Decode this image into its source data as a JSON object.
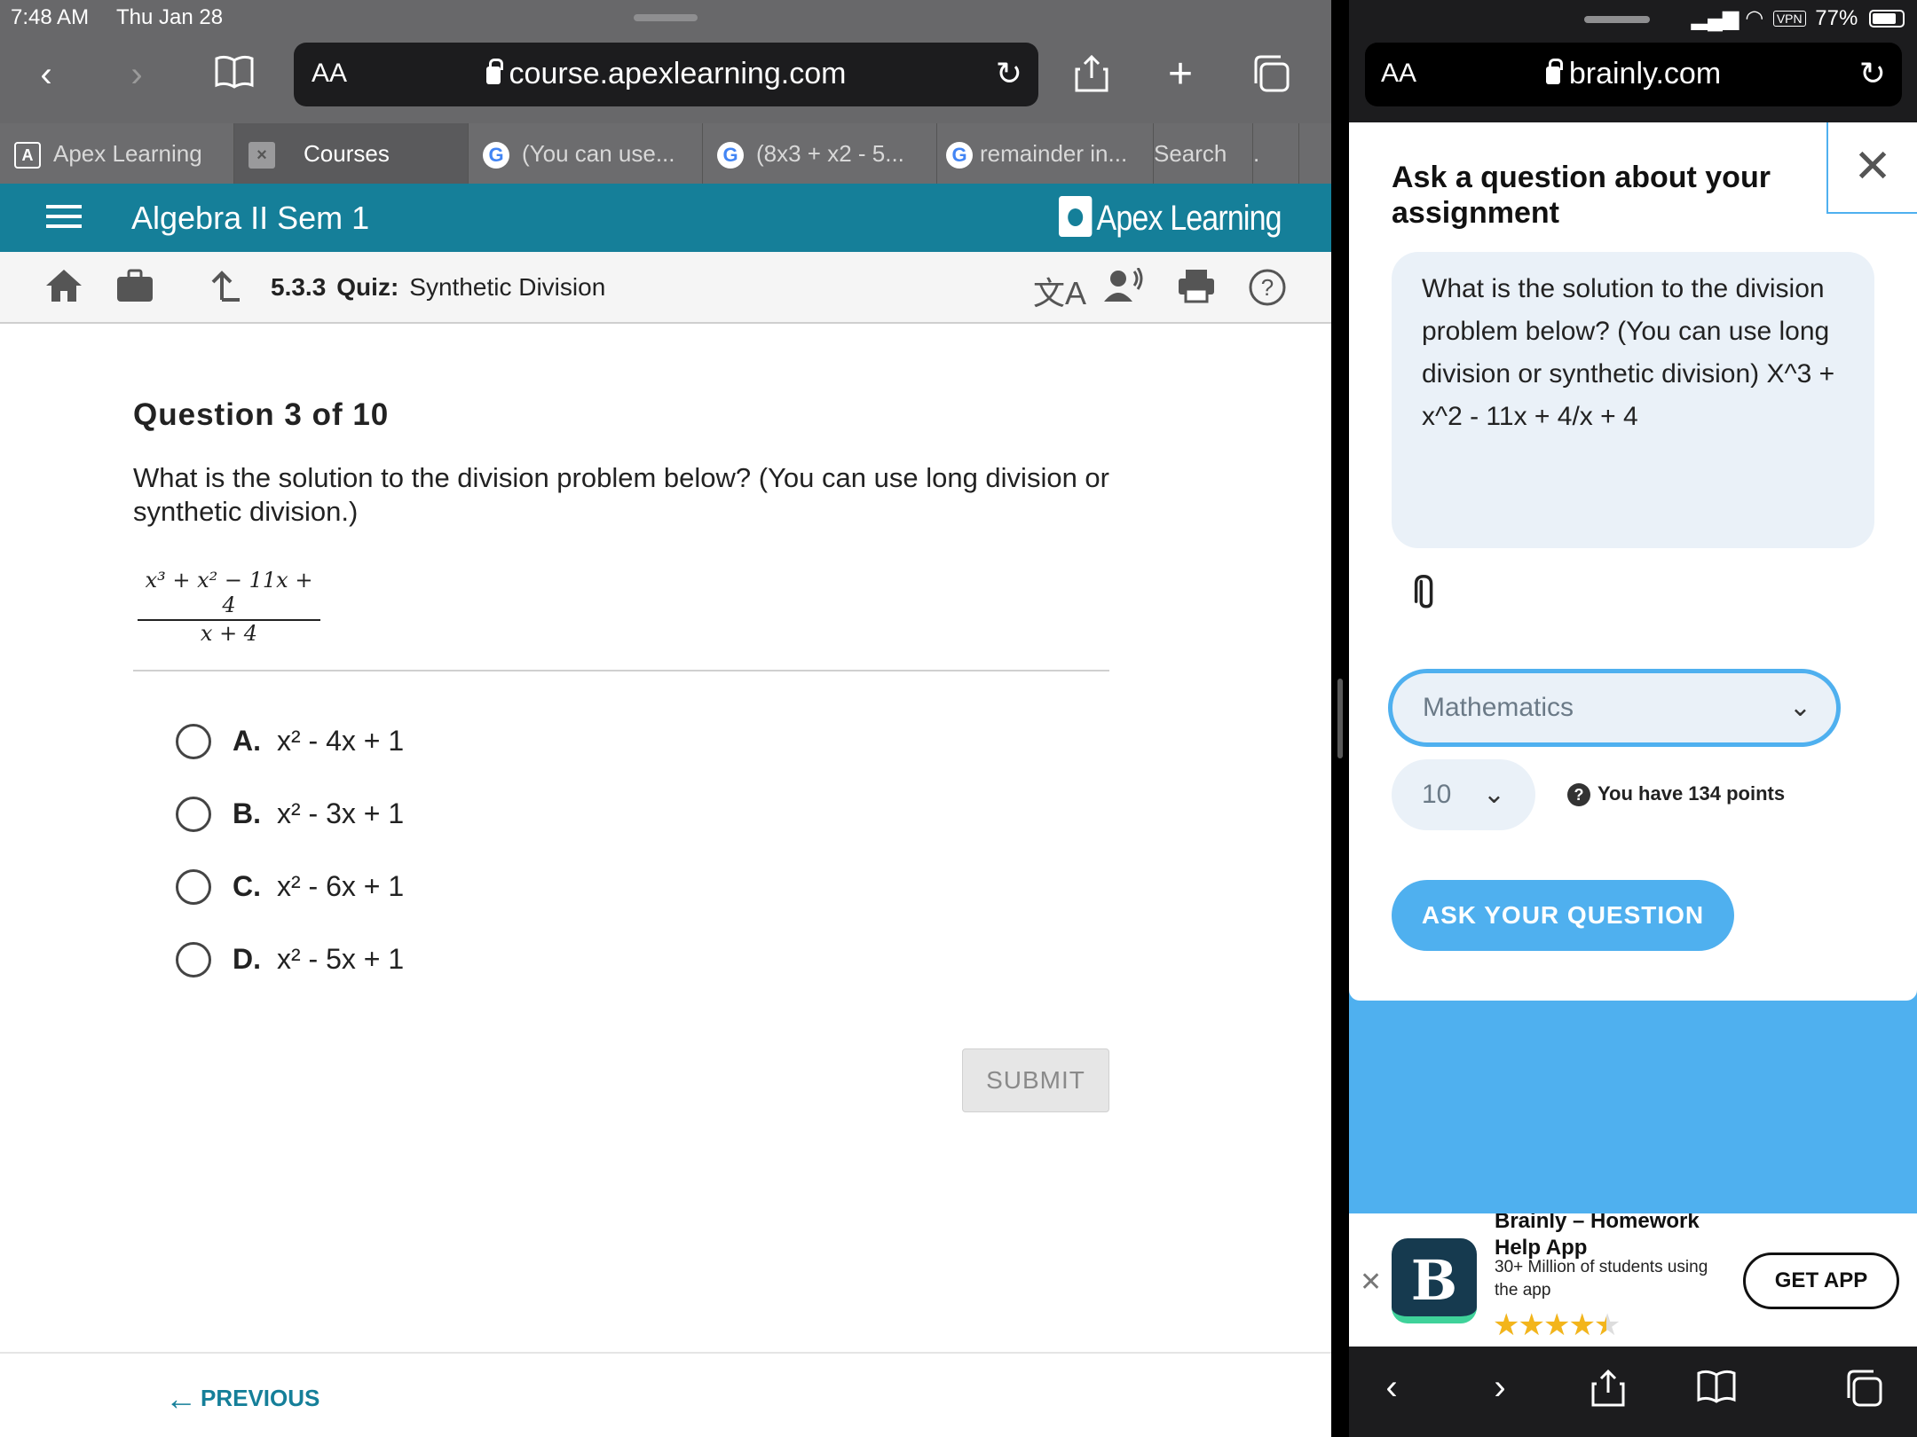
{
  "status": {
    "time": "7:48 AM",
    "date": "Thu Jan 28",
    "battery": "77%",
    "vpn": "VPN"
  },
  "left_browser": {
    "aa": "AA",
    "url": "course.apexlearning.com",
    "tabs": [
      {
        "label": "Apex Learning",
        "icon": "apex-tab-icon"
      },
      {
        "label": "Courses",
        "icon": "close-tab-icon"
      },
      {
        "label": "(You can use...",
        "icon": "google-tab-icon"
      },
      {
        "label": "(8x3 + x2 - 5...",
        "icon": "google-tab-icon"
      },
      {
        "label": "remainder in...",
        "icon": "google-tab-icon"
      },
      {
        "label": "Search",
        "icon": ""
      },
      {
        "label": ".",
        "icon": ""
      }
    ]
  },
  "apex": {
    "course_title": "Algebra II Sem 1",
    "logo_text": "Apex Learning",
    "breadcrumb": {
      "number": "5.3.3",
      "type": "Quiz:",
      "name": "Synthetic Division"
    },
    "question_header": "Question 3 of 10",
    "question_text": "What is the solution to the division problem below? (You can use long division or synthetic division.)",
    "fraction": {
      "numerator": "x³ + x² − 11x + 4",
      "denominator": "x + 4"
    },
    "options": [
      {
        "letter": "A.",
        "expr": "x² - 4x + 1"
      },
      {
        "letter": "B.",
        "expr": "x² - 3x + 1"
      },
      {
        "letter": "C.",
        "expr": "x² - 6x + 1"
      },
      {
        "letter": "D.",
        "expr": "x² - 5x + 1"
      }
    ],
    "submit_label": "SUBMIT",
    "previous_label": "PREVIOUS"
  },
  "right_browser": {
    "aa": "AA",
    "url": "brainly.com"
  },
  "brainly": {
    "heading": "Ask a question about your assignment",
    "question": "What is the solution to the division problem below? (You can use long division or synthetic division) X^3 + x^2 - 11x + 4/x + 4",
    "subject": "Mathematics",
    "points_value": "10",
    "points_info": "You have 134 points",
    "ask_button": "ASK YOUR QUESTION",
    "banner": {
      "title": "Brainly – Homework Help App",
      "subtitle": "30+ Million of students using the app",
      "rating": 4.5,
      "get_app": "GET APP"
    }
  }
}
